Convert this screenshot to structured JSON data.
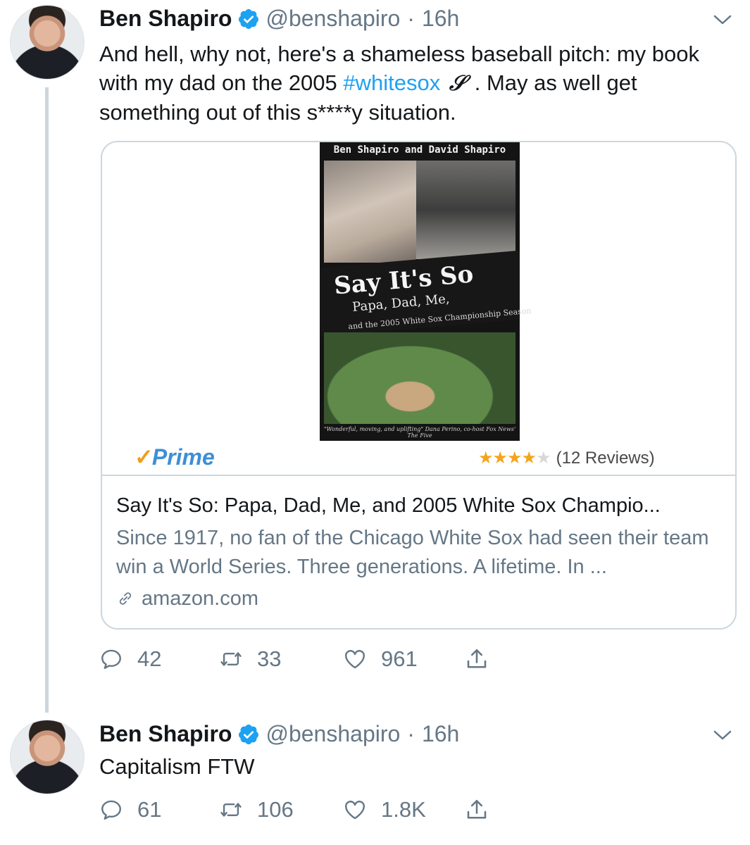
{
  "tweets": [
    {
      "name": "Ben Shapiro",
      "handle": "@benshapiro",
      "separator": "·",
      "time": "16h",
      "text_before": "And hell, why not, here's a shameless baseball pitch: my book with my dad on the 2005 ",
      "hashtag": "#whitesox",
      "sox_glyph": "Sox",
      "text_after": " . May as well get something out of this s****y situation.",
      "card": {
        "book": {
          "authors": "Ben Shapiro and David Shapiro",
          "title": "Say It's So",
          "subtitle": "Papa, Dad, Me,",
          "subtitle2": "and the 2005 White Sox Championship Season",
          "quote": "\"Wonderful, moving, and uplifting\" Dana Perino, co-host Fox News' The Five"
        },
        "prime_label": "Prime",
        "prime_check": "✓",
        "rating_value": 4,
        "rating_max": 5,
        "stars_filled": "★★★★",
        "stars_empty": "★",
        "reviews": "(12 Reviews)",
        "title": "Say It's So: Papa, Dad, Me, and 2005 White Sox Champio...",
        "description": "Since 1917, no fan of the Chicago White Sox had seen their team win a World Series. Three generations. A lifetime. In ...",
        "domain": "amazon.com"
      },
      "stats": {
        "replies": "42",
        "retweets": "33",
        "likes": "961"
      }
    },
    {
      "name": "Ben Shapiro",
      "handle": "@benshapiro",
      "separator": "·",
      "time": "16h",
      "text": "Capitalism FTW",
      "stats": {
        "replies": "61",
        "retweets": "106",
        "likes": "1.8K"
      }
    }
  ],
  "icons": {
    "verified": "verified-badge-icon",
    "caret": "chevron-down-icon",
    "reply": "reply-icon",
    "retweet": "retweet-icon",
    "like": "heart-icon",
    "share": "share-icon",
    "link": "link-icon"
  },
  "colors": {
    "accent": "#1da1f2",
    "secondary_text": "#657786",
    "border": "#ccd6dd",
    "prime_blue": "#3d8fd6",
    "prime_orange": "#f29c1b",
    "star": "#f4a41d"
  }
}
